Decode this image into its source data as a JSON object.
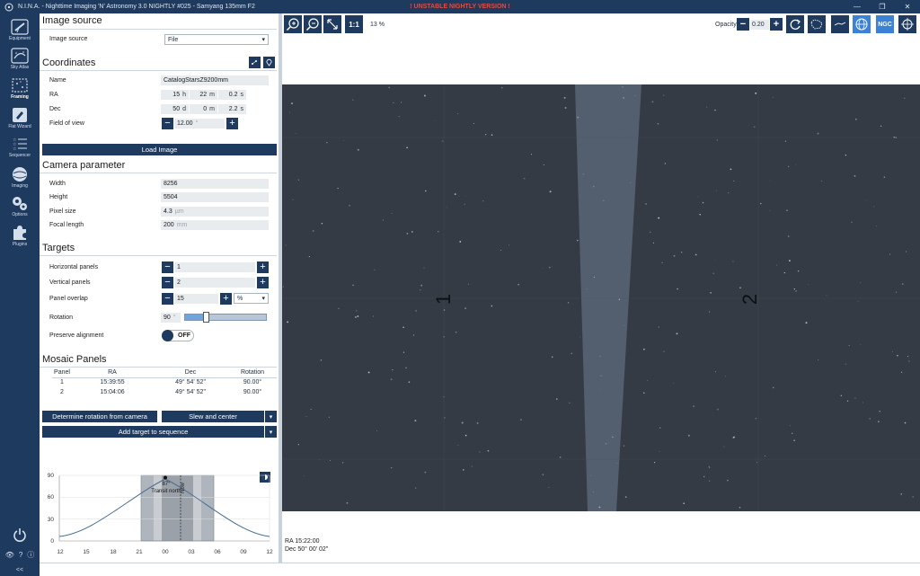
{
  "window": {
    "title": "N.I.N.A. - Nighttime Imaging 'N' Astronomy 3.0 NIGHTLY #025  -  Samyang 135mm F2",
    "warning": "! UNSTABLE NIGHTLY VERSION !"
  },
  "nav": {
    "items": [
      {
        "label": "Equipment",
        "icon": "telescope-icon"
      },
      {
        "label": "Sky Atlas",
        "icon": "sky-atlas-icon"
      },
      {
        "label": "Framing",
        "icon": "framing-icon"
      },
      {
        "label": "Flat Wizard",
        "icon": "flat-wizard-icon"
      },
      {
        "label": "Sequencer",
        "icon": "sequencer-icon"
      },
      {
        "label": "Imaging",
        "icon": "imaging-icon"
      },
      {
        "label": "Options",
        "icon": "gears-icon"
      },
      {
        "label": "Plugins",
        "icon": "puzzle-icon"
      }
    ],
    "collapse": "<<"
  },
  "image_source": {
    "title": "Image source",
    "label": "Image source",
    "value": "File"
  },
  "coordinates": {
    "title": "Coordinates",
    "name_label": "Name",
    "name_value": "CatalogStarsZ9200mm",
    "ra_label": "RA",
    "ra_h": "15",
    "ra_h_unit": "h",
    "ra_m": "22",
    "ra_m_unit": "m",
    "ra_s": "0.2",
    "ra_s_unit": "s",
    "dec_label": "Dec",
    "dec_d": "50",
    "dec_d_unit": "d",
    "dec_m": "0",
    "dec_m_unit": "m",
    "dec_s": "2.2",
    "dec_s_unit": "s",
    "fov_label": "Field of view",
    "fov_value": "12.00",
    "fov_unit": "°"
  },
  "load_image": "Load Image",
  "camera": {
    "title": "Camera parameter",
    "width_label": "Width",
    "width_value": "8256",
    "height_label": "Height",
    "height_value": "5504",
    "pixel_label": "Pixel size",
    "pixel_value": "4.3",
    "pixel_unit": "µm",
    "focal_label": "Focal length",
    "focal_value": "200",
    "focal_unit": "mm"
  },
  "targets": {
    "title": "Targets",
    "hpanels_label": "Horizontal panels",
    "hpanels_value": "1",
    "vpanels_label": "Vertical panels",
    "vpanels_value": "2",
    "overlap_label": "Panel overlap",
    "overlap_value": "15",
    "overlap_unit": "%",
    "rotation_label": "Rotation",
    "rotation_value": "90",
    "rotation_unit": "°",
    "rotation_fraction": 0.25,
    "preserve_label": "Preserve alignment",
    "preserve_value": "OFF"
  },
  "mosaic": {
    "title": "Mosaic Panels",
    "headers": [
      "Panel",
      "RA",
      "Dec",
      "Rotation"
    ],
    "rows": [
      [
        "1",
        "15:39:55",
        "49° 54' 52\"",
        "90.00°"
      ],
      [
        "2",
        "15:04:06",
        "49° 54' 52\"",
        "90.00°"
      ]
    ]
  },
  "actions": {
    "determine": "Determine rotation from camera",
    "slew": "Slew and center",
    "add_target": "Add target to sequence"
  },
  "altitude_chart": {
    "y_ticks": [
      "90",
      "60",
      "30",
      "0"
    ],
    "x_ticks": [
      "12",
      "15",
      "18",
      "21",
      "00",
      "03",
      "06",
      "09",
      "12"
    ],
    "peak_label": "87°",
    "transit_label": "Transit north",
    "now_label": "Now"
  },
  "toolbar": {
    "zoom_fit": "1:1",
    "zoom_level": "13 %",
    "opacity_label": "Opacity",
    "opacity_value": "0.20",
    "ngc": "NGC"
  },
  "view": {
    "panel1": "1",
    "panel2": "2",
    "ra_readout": "RA  15:22:00",
    "dec_readout": "Dec  50° 00' 02\""
  }
}
